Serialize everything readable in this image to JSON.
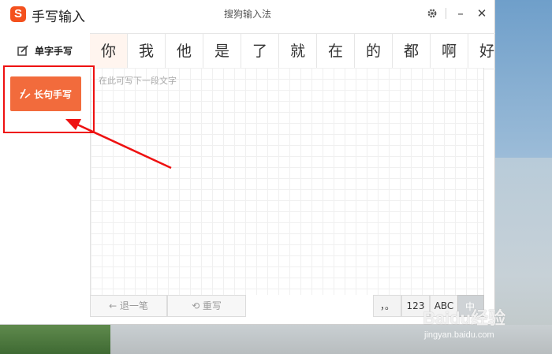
{
  "window": {
    "app_title": "手写输入",
    "center_title": "搜狗输入法",
    "logo_letter": "S",
    "controls": {
      "settings_icon": "gear-icon",
      "minimize_label": "–",
      "close_label": "✕"
    }
  },
  "sidebar": {
    "items": [
      {
        "label": "单字手写",
        "icon": "pen-square-icon",
        "selected": false
      },
      {
        "label": "长句手写",
        "icon": "sentence-write-icon",
        "selected": true
      }
    ]
  },
  "candidates": [
    "你",
    "我",
    "他",
    "是",
    "了",
    "就",
    "在",
    "的",
    "都",
    "啊",
    "好"
  ],
  "canvas": {
    "placeholder": "在此可写下一段文字"
  },
  "toolbar": {
    "undo_label": "← 退一笔",
    "rewrite_label": "⟲ 重写",
    "punct_label": "，。",
    "num_label": "123",
    "abc_label": "ABC",
    "corner_label": "中"
  },
  "watermark": {
    "main": "Baidu经验",
    "sub": "jingyan.baidu.com"
  },
  "colors": {
    "accent": "#f26b3c",
    "annotation": "#e11111"
  }
}
